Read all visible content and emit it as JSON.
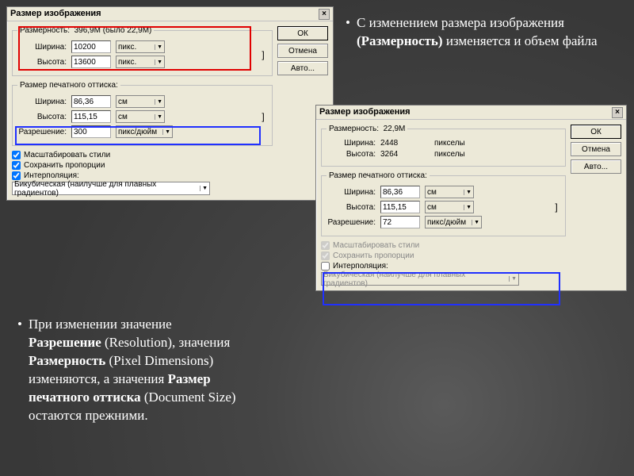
{
  "dialog1": {
    "title": "Размер изображения",
    "dim_legend": "Размерность:",
    "dim_value": "396,9M (было 22,9M)",
    "width_label": "Ширина:",
    "width_value": "10200",
    "width_unit": "пикс.",
    "height_label": "Высота:",
    "height_value": "13600",
    "height_unit": "пикс.",
    "print_legend": "Размер печатного оттиска:",
    "pwidth_label": "Ширина:",
    "pwidth_value": "86,36",
    "pwidth_unit": "см",
    "pheight_label": "Высота:",
    "pheight_value": "115,15",
    "pheight_unit": "см",
    "res_label": "Разрешение:",
    "res_value": "300",
    "res_unit": "пикс/дюйм",
    "scale_styles": "Масштабировать стили",
    "constrain": "Сохранить пропорции",
    "interp_label": "Интерполяция:",
    "interp_value": "Бикубическая (наилучше для плавных градиентов)",
    "ok": "ОК",
    "cancel": "Отмена",
    "auto": "Авто..."
  },
  "dialog2": {
    "title": "Размер изображения",
    "dim_legend": "Размерность:",
    "dim_value": "22,9M",
    "width_label": "Ширина:",
    "width_value": "2448",
    "width_unit": "пикселы",
    "height_label": "Высота:",
    "height_value": "3264",
    "height_unit": "пикселы",
    "print_legend": "Размер печатного оттиска:",
    "pwidth_label": "Ширина:",
    "pwidth_value": "86,36",
    "pwidth_unit": "см",
    "pheight_label": "Высота:",
    "pheight_value": "115,15",
    "pheight_unit": "см",
    "res_label": "Разрешение:",
    "res_value": "72",
    "res_unit": "пикс/дюйм",
    "scale_styles": "Масштабировать стили",
    "constrain": "Сохранить пропорции",
    "interp_label": "Интерполяция:",
    "interp_value": "Бикубическая (наилучше для плавных градиентов)",
    "ok": "ОК",
    "cancel": "Отмена",
    "auto": "Авто..."
  },
  "caption1": {
    "pre": "С изменением размера изображения ",
    "bold": "(Размерность)",
    "post": " изменяется и объем файла"
  },
  "caption2": {
    "p1": "При изменении значение ",
    "b1": "Разрешение",
    "p2": " (Resolution), значения ",
    "b2": "Размерность",
    "p3": " (Pixel Dimensions) изменяются, а значения ",
    "b3": "Размер печатного оттиска",
    "p4": " (Document Size) остаются прежними."
  }
}
